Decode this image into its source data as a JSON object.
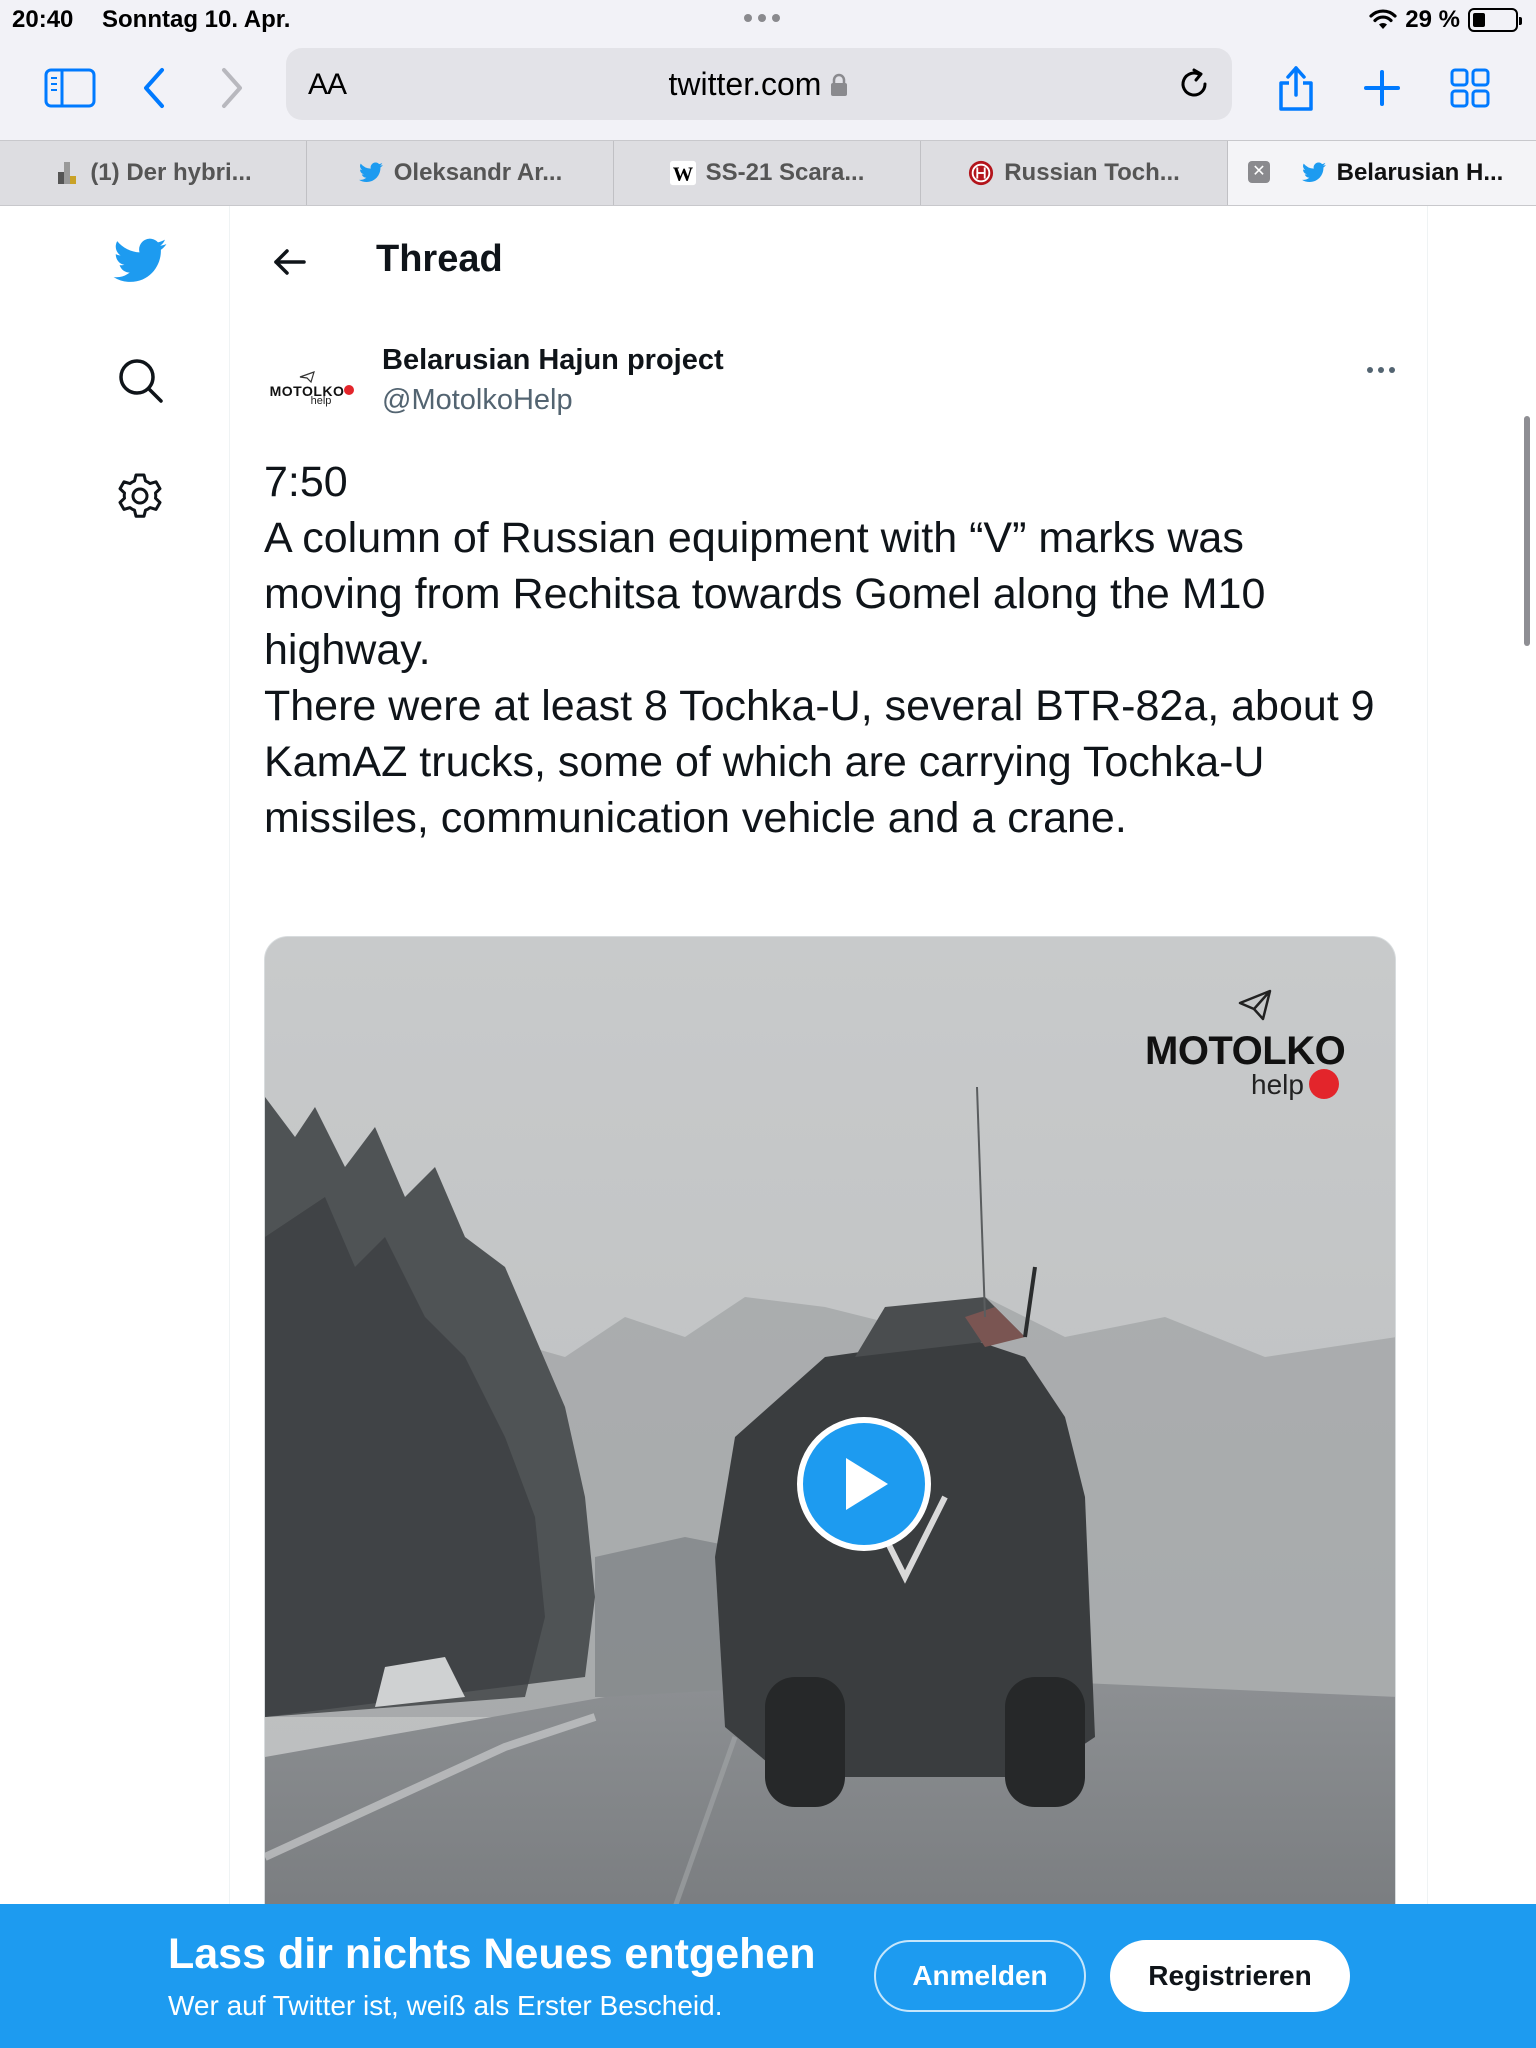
{
  "status_bar": {
    "time": "20:40",
    "date": "Sonntag 10. Apr.",
    "battery": "29 %",
    "battery_level": 0.29
  },
  "browser": {
    "aa_label": "AA",
    "url": "twitter.com",
    "tabs": [
      {
        "title": "(1) Der hybri...",
        "icon": "document-favicon"
      },
      {
        "title": "Oleksandr Ar...",
        "icon": "twitter-favicon"
      },
      {
        "title": "SS-21 Scara...",
        "icon": "wikipedia-favicon"
      },
      {
        "title": "Russian Toch...",
        "icon": "red-circle-favicon"
      },
      {
        "title": "Belarusian H...",
        "icon": "twitter-favicon",
        "active": true
      }
    ]
  },
  "thread": {
    "title": "Thread",
    "author": {
      "name": "Belarusian Hajun project",
      "handle": "@MotolkoHelp",
      "avatar_text": "MOTOLKO",
      "avatar_sub": "help"
    },
    "text": {
      "line1": "7:50",
      "para1": "A column of Russian equipment with “V” marks was moving from Rechitsa towards Gomel along the M10 highway.",
      "para2": "There were at least 8 Tochka-U, several BTR-82a, about 9 KamAZ trucks, some of which are carrying Tochka-U missiles, communication vehicle and a crane."
    },
    "media": {
      "watermark": "MOTOLKO",
      "watermark_sub": "help",
      "play_icon": "play-icon"
    }
  },
  "banner": {
    "title": "Lass dir nichts Neues entgehen",
    "subtitle": "Wer auf Twitter ist, weiß als Erster Bescheid.",
    "login": "Anmelden",
    "register": "Registrieren"
  },
  "colors": {
    "twitter_blue": "#1d9bf0",
    "ios_blue": "#007aff",
    "text_gray": "#536471"
  }
}
